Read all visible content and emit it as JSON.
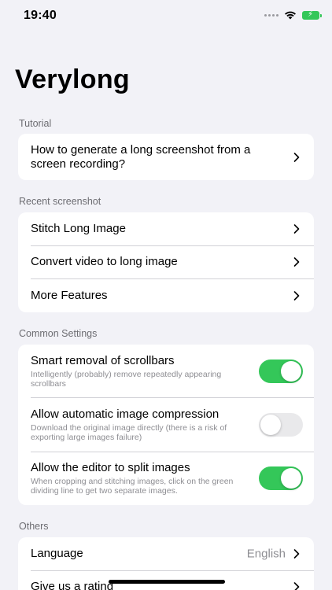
{
  "status": {
    "time": "19:40"
  },
  "app": {
    "title": "Verylong"
  },
  "sections": {
    "tutorial": {
      "header": "Tutorial",
      "item": "How to generate a long screenshot from a screen recording?"
    },
    "recent": {
      "header": "Recent screenshot",
      "items": [
        "Stitch Long Image",
        "Convert video to long image",
        "More Features"
      ]
    },
    "common": {
      "header": "Common Settings",
      "settings": [
        {
          "title": "Smart removal of scrollbars",
          "subtitle": "Intelligently (probably) remove repeatedly appearing scrollbars",
          "enabled": true
        },
        {
          "title": "Allow automatic image compression",
          "subtitle": "Download the original image directly (there is a risk of exporting large images failure)",
          "enabled": false
        },
        {
          "title": "Allow the editor to split images",
          "subtitle": "When cropping and stitching images, click on the green dividing line to get two separate images.",
          "enabled": true
        }
      ]
    },
    "others": {
      "header": "Others",
      "language_label": "Language",
      "language_value": "English",
      "rate_label": "Give us a rating"
    }
  },
  "colors": {
    "accent_green": "#34c759",
    "background": "#f2f2f7"
  },
  "icons": [
    "wifi-icon",
    "battery-charging-icon",
    "chevron-right-icon"
  ]
}
